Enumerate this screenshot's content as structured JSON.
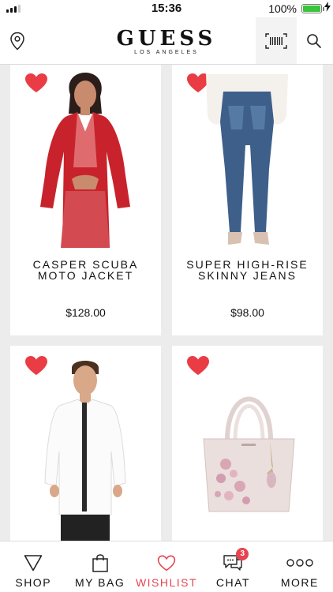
{
  "status_bar": {
    "time": "15:36",
    "battery_percent": "100%",
    "battery_level": 1.0,
    "signal_bars": 3
  },
  "header": {
    "logo": "GUESS",
    "logo_subtitle": "LOS ANGELES",
    "icons": {
      "location": "location-pin-icon",
      "barcode": "barcode-scan-icon",
      "search": "search-icon"
    }
  },
  "colors": {
    "accent": "#e64450",
    "heart": "#ea3c44",
    "battery": "#39c63a",
    "background": "#ececec"
  },
  "products": [
    {
      "name_line1": "CASPER SCUBA",
      "name_line2": "MOTO JACKET",
      "price": "$128.00",
      "favorited": true
    },
    {
      "name_line1": "SUPER HIGH-RISE",
      "name_line2": "SKINNY JEANS",
      "price": "$98.00",
      "favorited": true
    },
    {
      "name_line1": "",
      "name_line2": "",
      "price": "",
      "favorited": true
    },
    {
      "name_line1": "",
      "name_line2": "",
      "price": "",
      "favorited": true
    }
  ],
  "tabs": [
    {
      "label": "SHOP",
      "icon": "shop-triangle-icon",
      "active": false
    },
    {
      "label": "MY BAG",
      "icon": "bag-icon",
      "active": false
    },
    {
      "label": "WISHLIST",
      "icon": "heart-icon",
      "active": true
    },
    {
      "label": "CHAT",
      "icon": "chat-icon",
      "active": false,
      "badge": "3"
    },
    {
      "label": "MORE",
      "icon": "more-dots-icon",
      "active": false
    }
  ]
}
